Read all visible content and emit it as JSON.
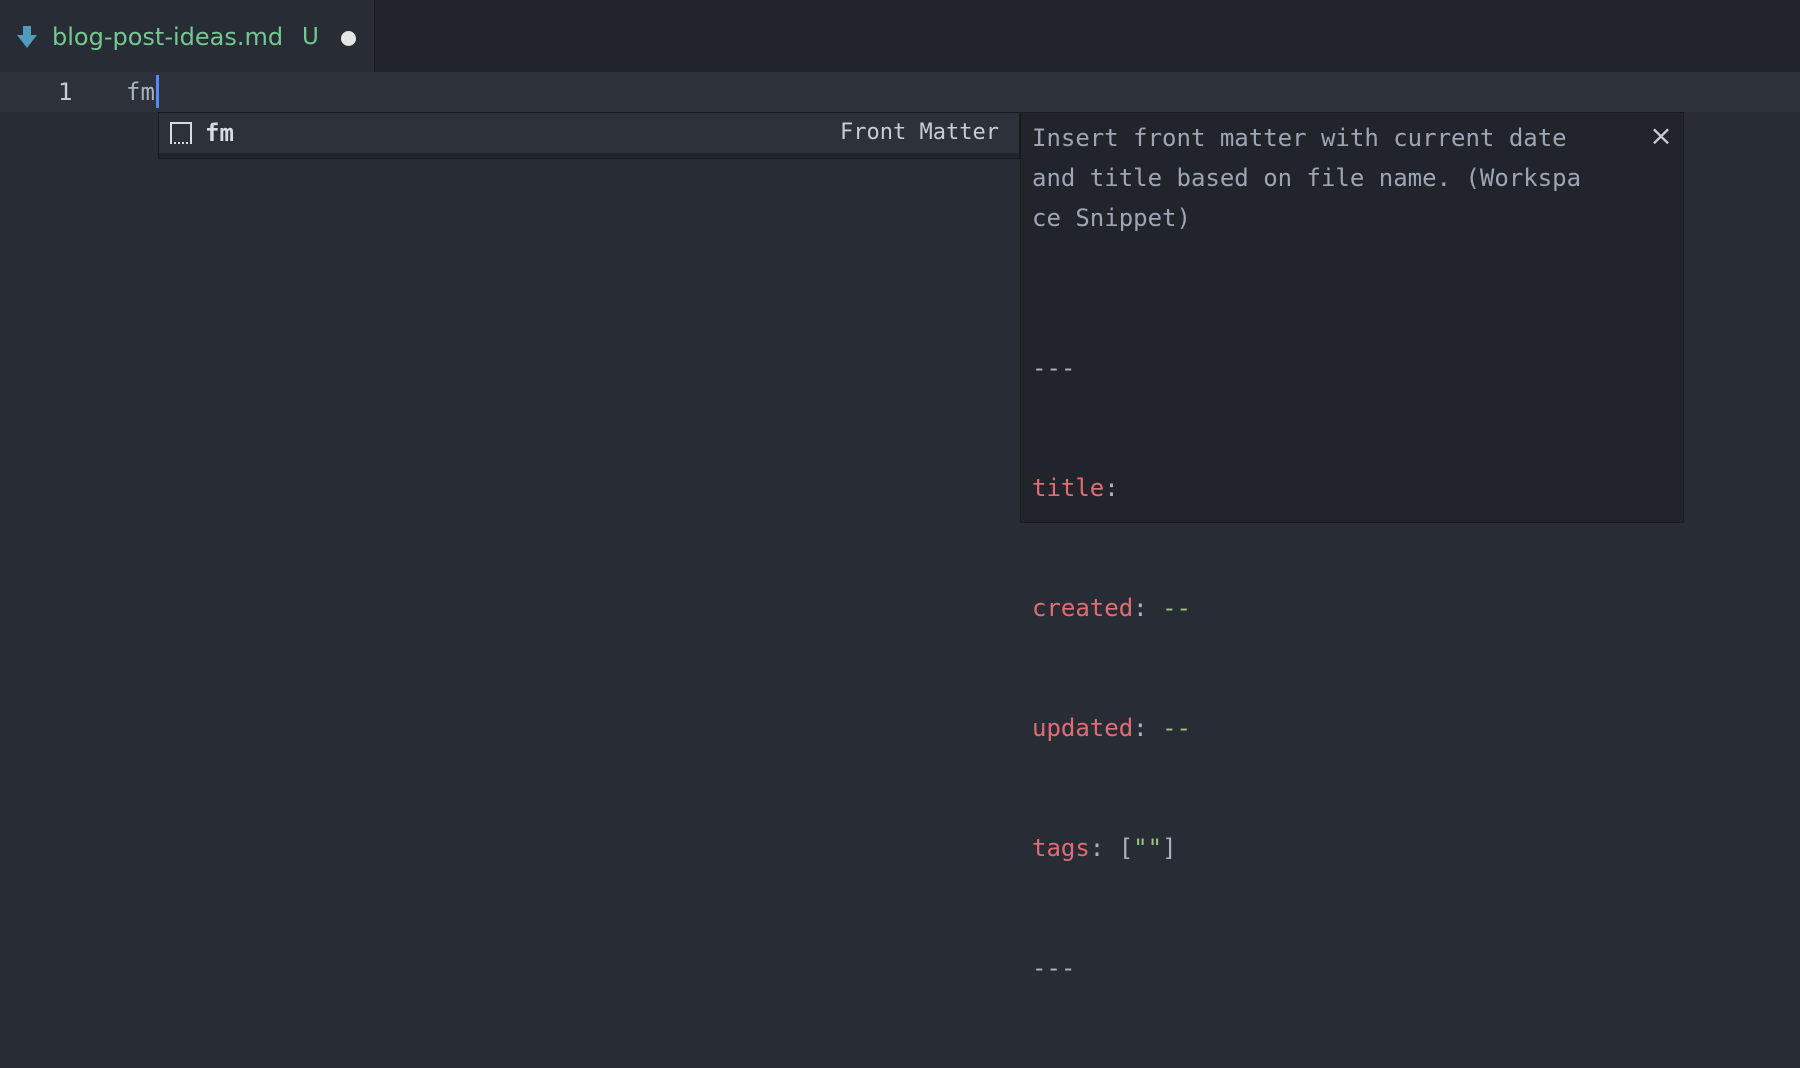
{
  "tab": {
    "icon": "markdown-arrow-icon",
    "title": "blog-post-ideas.md",
    "git_status": "U",
    "dirty_indicator": "unsaved-dot"
  },
  "colors": {
    "background": "#282c34",
    "tab_title": "#73c991",
    "icon": "#519aba",
    "cursor": "#528bff",
    "key": "#e06c75",
    "string": "#98c379"
  },
  "editor": {
    "line_number": "1",
    "text": "fm"
  },
  "suggest": {
    "icon": "snippet-icon",
    "label": "fm",
    "detail": "Front Matter"
  },
  "details": {
    "doc_lines": [
      "Insert front matter with current date",
      "and title based on file name. (Workspa",
      "ce Snippet)"
    ],
    "close_icon": "×",
    "code": {
      "open": "---",
      "title_key": "title",
      "created_key": "created",
      "created_value": "--",
      "updated_key": "updated",
      "updated_value": "--",
      "tags_key": "tags",
      "tags_open": "[",
      "tags_value": "\"\"",
      "tags_close": "]",
      "colon": ":",
      "close": "---"
    }
  }
}
